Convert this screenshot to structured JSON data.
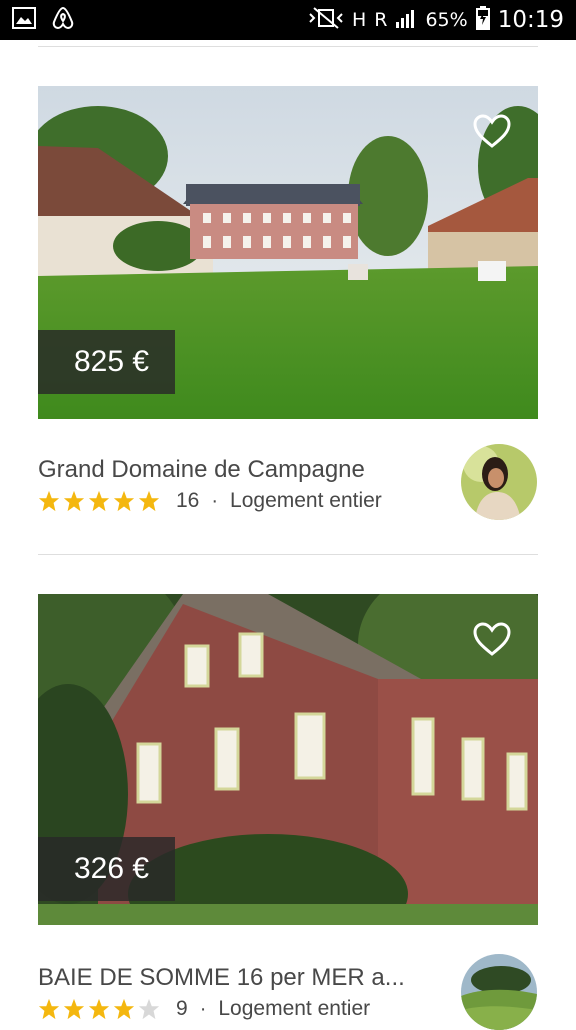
{
  "status_bar": {
    "battery": "65%",
    "time": "10:19",
    "network_label_1": "H",
    "network_label_2": "R",
    "icons": [
      "gallery-icon",
      "airbnb-logo-icon",
      "vibrate-mute-icon",
      "signal-icon",
      "battery-icon"
    ]
  },
  "listings": [
    {
      "price": "825 €",
      "title": "Grand Domaine de Campagne",
      "rating_stars": 5,
      "review_count": "16",
      "separator": "·",
      "room_type": "Logement entier"
    },
    {
      "price": "326 €",
      "title": "BAIE DE SOMME  16 per MER a...",
      "rating_stars": 4,
      "review_count": "9",
      "separator": "·",
      "room_type": "Logement entier"
    }
  ],
  "colors": {
    "star_filled": "#F4B70F",
    "star_empty": "#D8D8D8",
    "price_tag_bg": "#282828"
  }
}
